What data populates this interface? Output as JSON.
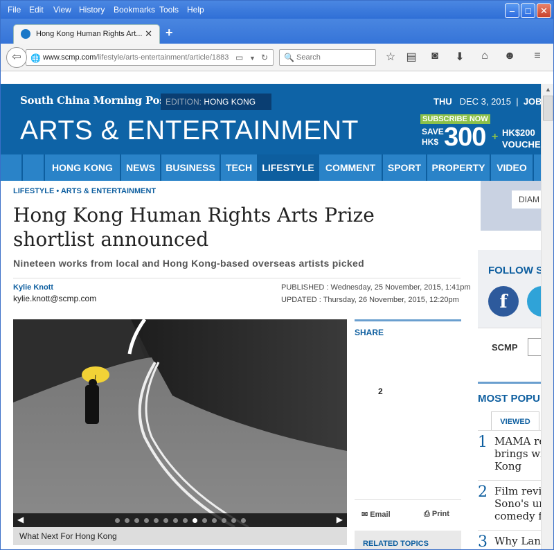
{
  "menubar": {
    "items": [
      "File",
      "Edit",
      "View",
      "History",
      "Bookmarks",
      "Tools",
      "Help"
    ]
  },
  "tab": {
    "title": "Hong Kong Human Rights Art...",
    "new_tab": "+"
  },
  "nav": {
    "url_host": "www.scmp.com",
    "url_path": "/lifestyle/arts-entertainment/article/1883",
    "search_placeholder": "Search"
  },
  "site": {
    "logo": "South China Morning Post",
    "edition_key": "EDITION:",
    "edition_value": "HONG KONG",
    "day": "THU",
    "date": "DEC 3, 2015",
    "jobs": "JOBS",
    "section_title": "ARTS & ENTERTAINMENT",
    "promo": {
      "subscribe": "SUBSCRIBE NOW",
      "save1": "SAVE",
      "save2": "HK$",
      "amount": "300",
      "plus": "+",
      "voucher1": "HK$200",
      "voucher2": "VOUCHER"
    },
    "nav_items": [
      "HONG KONG",
      "NEWS",
      "BUSINESS",
      "TECH",
      "LIFESTYLE",
      "COMMENT",
      "SPORT",
      "PROPERTY",
      "VIDEO"
    ]
  },
  "article": {
    "crumb1": "LIFESTYLE",
    "crumb_sep": "•",
    "crumb2": "ARTS & ENTERTAINMENT",
    "headline": "Hong Kong Human Rights Arts Prize shortlist announced",
    "subhead": "Nineteen works from local and Hong Kong-based overseas artists picked",
    "author": "Kylie Knott",
    "email": "kylie.knott@scmp.com",
    "published": "PUBLISHED : Wednesday, 25 November, 2015, 1:41pm",
    "updated": "UPDATED : Thursday, 26 November, 2015, 12:20pm",
    "caption": "What Next For Hong Kong",
    "gallery": {
      "total": 14,
      "active": 9
    }
  },
  "share": {
    "label": "SHARE",
    "count": "2",
    "email": "Email",
    "print": "Print",
    "related": "RELATED TOPICS"
  },
  "sidebar": {
    "ad_text": "DIAM",
    "follow": "FOLLOW S",
    "scmp": "SCMP",
    "most_popular": "MOST POPU",
    "viewed_tab": "VIEWED",
    "popular": [
      {
        "n": "1",
        "text": "MAMA re\nbrings wi\nKong"
      },
      {
        "n": "2",
        "text": "Film revi\nSono's ur\ncomedy f"
      },
      {
        "n": "3",
        "text": "Why Lan"
      }
    ]
  }
}
